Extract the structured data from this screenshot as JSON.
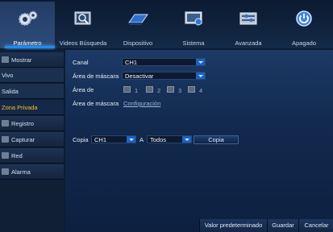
{
  "tabs": [
    {
      "label": "Parámetro",
      "icon": "gear-icon"
    },
    {
      "label": "Videos Búsqueda",
      "icon": "search-video-icon"
    },
    {
      "label": "Dispositivo",
      "icon": "hard-disk-icon"
    },
    {
      "label": "Sistema",
      "icon": "system-monitor-icon"
    },
    {
      "label": "Avanzada",
      "icon": "advanced-settings-icon"
    },
    {
      "label": "Apagado",
      "icon": "power-icon"
    }
  ],
  "sidebar": {
    "mostrar": "Mostrar",
    "vivo": "Vivo",
    "salida": "Salida",
    "zona_privada": "Zona Privada",
    "registro": "Registro",
    "capturar": "Capturar",
    "red": "Red",
    "alarma": "Alarma"
  },
  "form": {
    "canal_label": "Canal",
    "canal_value": "CH1",
    "area_mascara_label": "Área de máscara",
    "area_mascara_value": "Desactivar",
    "area_de_label": "Área de",
    "areas": [
      "1",
      "2",
      "3",
      "4"
    ],
    "area_mascara2_label": "Área de máscara",
    "configuracion_link": "Configuración",
    "copia_label": "Copia",
    "copia_value": "CH1",
    "a_label": "A",
    "a_value": "Todos",
    "copia_button": "Copia"
  },
  "footer": {
    "default_button": "Valor predeterminado",
    "save_button": "Guardar",
    "cancel_button": "Cancelar"
  },
  "colors": {
    "accent": "#1e8cf0",
    "active_text": "#f6c01c",
    "background": "#0c1c33"
  }
}
